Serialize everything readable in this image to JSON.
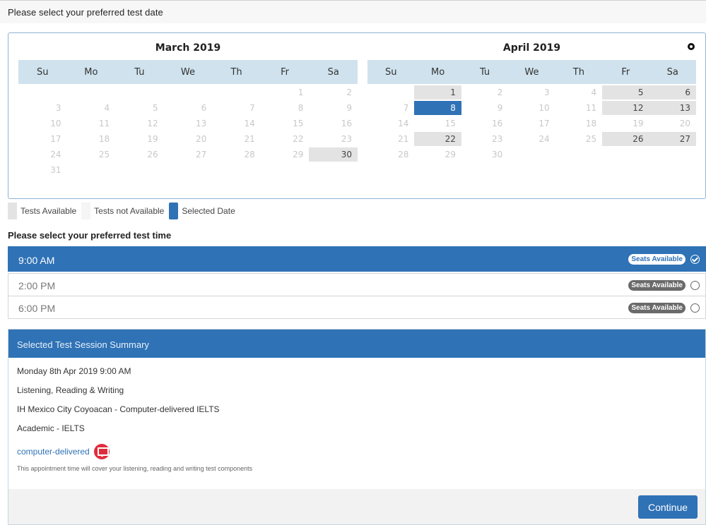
{
  "header": {
    "title": "Please select your preferred test date"
  },
  "calendar": {
    "months": [
      {
        "title": "March 2019",
        "weekdays": [
          "Su",
          "Mo",
          "Tu",
          "We",
          "Th",
          "Fr",
          "Sa"
        ],
        "weeks": [
          [
            null,
            null,
            null,
            null,
            null,
            {
              "d": "1"
            },
            {
              "d": "2"
            }
          ],
          [
            {
              "d": "3"
            },
            {
              "d": "4"
            },
            {
              "d": "5"
            },
            {
              "d": "6"
            },
            {
              "d": "7"
            },
            {
              "d": "8"
            },
            {
              "d": "9"
            }
          ],
          [
            {
              "d": "10"
            },
            {
              "d": "11"
            },
            {
              "d": "12"
            },
            {
              "d": "13"
            },
            {
              "d": "14"
            },
            {
              "d": "15"
            },
            {
              "d": "16"
            }
          ],
          [
            {
              "d": "17"
            },
            {
              "d": "18"
            },
            {
              "d": "19"
            },
            {
              "d": "20"
            },
            {
              "d": "21"
            },
            {
              "d": "22"
            },
            {
              "d": "23"
            }
          ],
          [
            {
              "d": "24"
            },
            {
              "d": "25"
            },
            {
              "d": "26"
            },
            {
              "d": "27"
            },
            {
              "d": "28"
            },
            {
              "d": "29"
            },
            {
              "d": "30",
              "s": "avail"
            }
          ],
          [
            {
              "d": "31"
            },
            null,
            null,
            null,
            null,
            null,
            null
          ]
        ]
      },
      {
        "title": "April 2019",
        "weekdays": [
          "Su",
          "Mo",
          "Tu",
          "We",
          "Th",
          "Fr",
          "Sa"
        ],
        "weeks": [
          [
            null,
            {
              "d": "1",
              "s": "avail"
            },
            {
              "d": "2"
            },
            {
              "d": "3"
            },
            {
              "d": "4"
            },
            {
              "d": "5",
              "s": "avail"
            },
            {
              "d": "6",
              "s": "avail"
            }
          ],
          [
            {
              "d": "7"
            },
            {
              "d": "8",
              "s": "selected"
            },
            {
              "d": "9"
            },
            {
              "d": "10"
            },
            {
              "d": "11"
            },
            {
              "d": "12",
              "s": "avail"
            },
            {
              "d": "13",
              "s": "avail"
            }
          ],
          [
            {
              "d": "14"
            },
            {
              "d": "15"
            },
            {
              "d": "16"
            },
            {
              "d": "17"
            },
            {
              "d": "18"
            },
            {
              "d": "19"
            },
            {
              "d": "20"
            }
          ],
          [
            {
              "d": "21"
            },
            {
              "d": "22",
              "s": "avail"
            },
            {
              "d": "23"
            },
            {
              "d": "24"
            },
            {
              "d": "25"
            },
            {
              "d": "26",
              "s": "avail"
            },
            {
              "d": "27",
              "s": "avail"
            }
          ],
          [
            {
              "d": "28"
            },
            {
              "d": "29"
            },
            {
              "d": "30"
            },
            null,
            null,
            null,
            null
          ]
        ]
      }
    ],
    "next_icon": "next-month-icon"
  },
  "legend": {
    "available": "Tests Available",
    "not_available": "Tests not Available",
    "selected": "Selected Date"
  },
  "time": {
    "title": "Please select your preferred test time",
    "slots": [
      {
        "time": "9:00 AM",
        "badge": "Seats Available",
        "selected": true
      },
      {
        "time": "2:00 PM",
        "badge": "Seats Available",
        "selected": false
      },
      {
        "time": "6:00 PM",
        "badge": "Seats Available",
        "selected": false
      }
    ]
  },
  "summary": {
    "title": "Selected Test Session Summary",
    "datetime": "Monday 8th Apr 2019 9:00 AM",
    "components": "Listening, Reading & Writing",
    "venue": "IH Mexico City Coyoacan - Computer-delivered IELTS",
    "test_type": "Academic - IELTS",
    "mode_link": "computer-delivered",
    "mode_icon": "monitor-icon",
    "note": "This appointment time will cover your listening, reading and writing test components"
  },
  "footer": {
    "continue_label": "Continue"
  },
  "colors": {
    "accent": "#2f72b6",
    "available": "#e3e3e3",
    "header_row": "#cfe2ed",
    "icon_red": "#e02d3c"
  }
}
